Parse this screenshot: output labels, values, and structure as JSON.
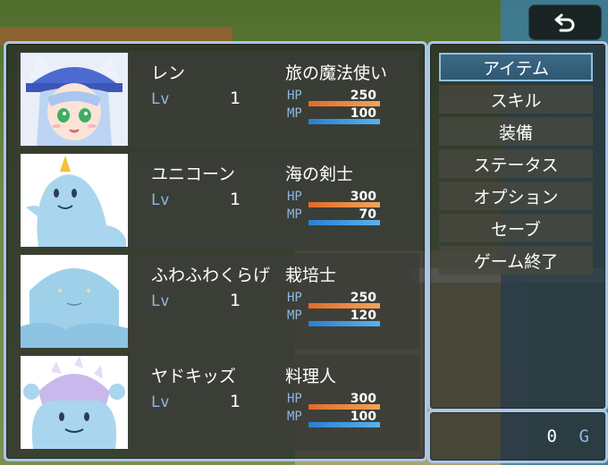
{
  "ui": {
    "back_icon": "back-arrow-icon",
    "accent": "#a9c7e6",
    "hp_color": "#e8873a",
    "mp_color": "#3b98de"
  },
  "party": [
    {
      "name": "レン",
      "level_label": "Lv",
      "level": "1",
      "class": "旅の魔法使い",
      "hp_label": "HP",
      "hp": "250",
      "hp_ratio": 1.0,
      "mp_label": "MP",
      "mp": "100",
      "mp_ratio": 1.0,
      "portrait": "witch-girl-portrait"
    },
    {
      "name": "ユニコーン",
      "level_label": "Lv",
      "level": "1",
      "class": "海の剣士",
      "hp_label": "HP",
      "hp": "300",
      "hp_ratio": 1.0,
      "mp_label": "MP",
      "mp": "70",
      "mp_ratio": 1.0,
      "portrait": "unicorn-slug-portrait"
    },
    {
      "name": "ふわふわくらげ",
      "level_label": "Lv",
      "level": "1",
      "class": "栽培士",
      "hp_label": "HP",
      "hp": "250",
      "hp_ratio": 1.0,
      "mp_label": "MP",
      "mp": "120",
      "mp_ratio": 1.0,
      "portrait": "jellyfish-portrait"
    },
    {
      "name": "ヤドキッズ",
      "level_label": "Lv",
      "level": "1",
      "class": "料理人",
      "hp_label": "HP",
      "hp": "300",
      "hp_ratio": 1.0,
      "mp_label": "MP",
      "mp": "100",
      "mp_ratio": 1.0,
      "portrait": "hermit-crab-portrait"
    }
  ],
  "menu": {
    "items": [
      "アイテム",
      "スキル",
      "装備",
      "ステータス",
      "オプション",
      "セーブ",
      "ゲーム終了"
    ],
    "selected_index": 0
  },
  "gold": {
    "value": "0",
    "unit": "G"
  }
}
